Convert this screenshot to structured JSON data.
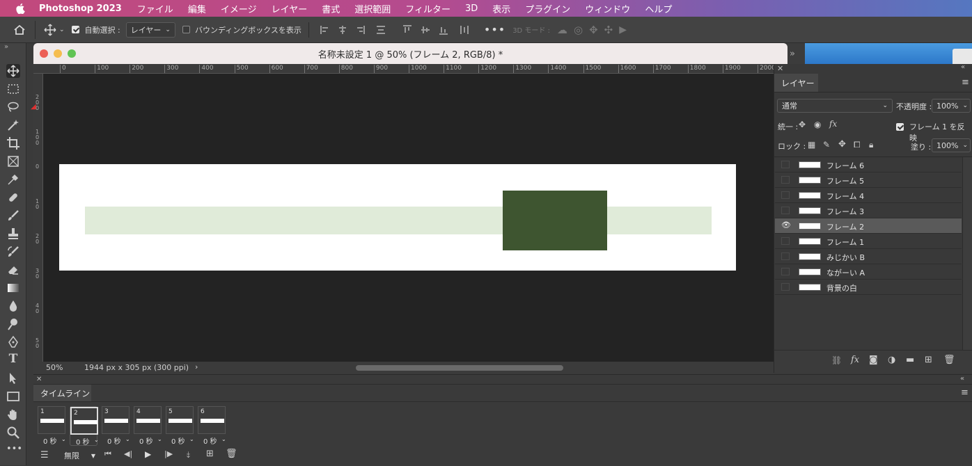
{
  "menubar": {
    "app": "Photoshop 2023",
    "items": [
      "ファイル",
      "編集",
      "イメージ",
      "レイヤー",
      "書式",
      "選択範囲",
      "フィルター",
      "3D",
      "表示",
      "プラグイン",
      "ウィンドウ",
      "ヘルプ"
    ]
  },
  "options": {
    "auto_select_label": "自動選択 :",
    "auto_select_value": "レイヤー",
    "bbox_label": "バウンディングボックスを表示",
    "mode_3d_label": "3D モード :"
  },
  "document": {
    "title": "名称未設定 1 @ 50% (フレーム 2, RGB/8) *",
    "zoom": "50%",
    "size_info": "1944 px x 305 px (300 ppi)",
    "ruler_top": [
      "0",
      "100",
      "200",
      "300",
      "400",
      "500",
      "600",
      "700",
      "800",
      "900",
      "1000",
      "1100",
      "1200",
      "1300",
      "1400",
      "1500",
      "1600",
      "1700",
      "1800",
      "1900",
      "2000"
    ],
    "ruler_left": [
      "2\n0\n0",
      "1\n0\n0",
      "0",
      "1\n0",
      "2\n0",
      "3\n0",
      "4\n0",
      "5\n0"
    ]
  },
  "artwork": {
    "bar_color": "#e0ebd9",
    "block_color": "#3e5530",
    "bg_color": "#ffffff"
  },
  "layers_panel": {
    "tab": "レイヤー",
    "blend_mode": "通常",
    "opacity_label": "不透明度 :",
    "opacity_value": "100%",
    "unify_label": "統一 :",
    "propagate_label": "フレーム 1 を反映",
    "lock_label": "ロック :",
    "fill_label": "塗り :",
    "fill_value": "100%",
    "layers": [
      {
        "name": "フレーム 6",
        "visible": false,
        "selected": false
      },
      {
        "name": "フレーム 5",
        "visible": false,
        "selected": false
      },
      {
        "name": "フレーム 4",
        "visible": false,
        "selected": false
      },
      {
        "name": "フレーム 3",
        "visible": false,
        "selected": false
      },
      {
        "name": "フレーム 2",
        "visible": true,
        "selected": true
      },
      {
        "name": "フレーム 1",
        "visible": false,
        "selected": false
      },
      {
        "name": "みじかい B",
        "visible": false,
        "selected": false
      },
      {
        "name": "ながーい A",
        "visible": false,
        "selected": false
      },
      {
        "name": "背景の白",
        "visible": false,
        "selected": false
      }
    ]
  },
  "timeline": {
    "tab": "タイムライン",
    "loop": "無限",
    "frames": [
      {
        "num": "1",
        "delay": "0 秒"
      },
      {
        "num": "2",
        "delay": "0 秒"
      },
      {
        "num": "3",
        "delay": "0 秒"
      },
      {
        "num": "4",
        "delay": "0 秒"
      },
      {
        "num": "5",
        "delay": "0 秒"
      },
      {
        "num": "6",
        "delay": "0 秒"
      }
    ]
  }
}
